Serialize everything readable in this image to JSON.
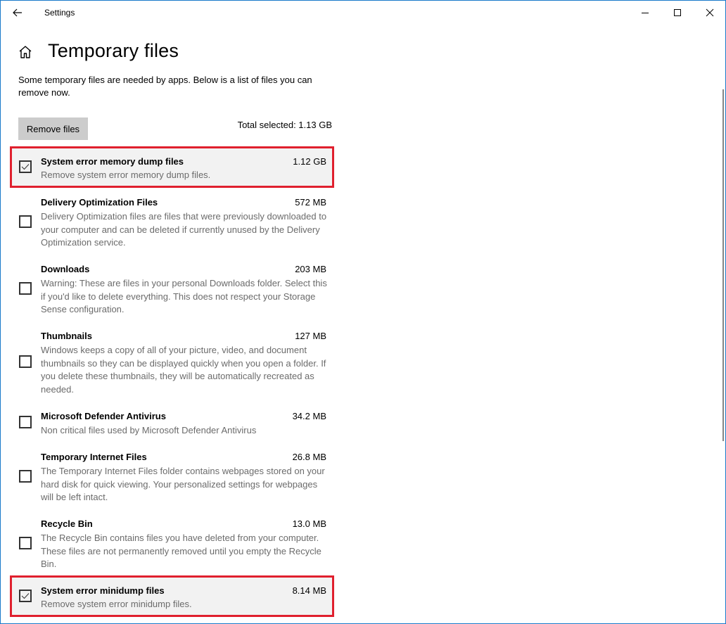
{
  "window": {
    "app_title": "Settings",
    "back_icon": "back-arrow-icon",
    "controls": {
      "minimize_icon": "minimize-icon",
      "maximize_icon": "maximize-icon",
      "close_icon": "close-icon"
    },
    "border_color": "#1979ca"
  },
  "page": {
    "home_icon": "home-icon",
    "title": "Temporary files",
    "intro": "Some temporary files are needed by apps. Below is a list of files you can remove now.",
    "remove_button_label": "Remove files",
    "total_selected": "Total selected: 1.13 GB"
  },
  "highlight_color": "#e0202e",
  "items": [
    {
      "name": "System error memory dump files",
      "size": "1.12 GB",
      "description": "Remove system error memory dump files.",
      "checked": true,
      "highlighted": true
    },
    {
      "name": "Delivery Optimization Files",
      "size": "572 MB",
      "description": "Delivery Optimization files are files that were previously downloaded to your computer and can be deleted if currently unused by the Delivery Optimization service.",
      "checked": false,
      "highlighted": false
    },
    {
      "name": "Downloads",
      "size": "203 MB",
      "description": "Warning: These are files in your personal Downloads folder. Select this if you'd like to delete everything. This does not respect your Storage Sense configuration.",
      "checked": false,
      "highlighted": false
    },
    {
      "name": "Thumbnails",
      "size": "127 MB",
      "description": "Windows keeps a copy of all of your picture, video, and document thumbnails so they can be displayed quickly when you open a folder. If you delete these thumbnails, they will be automatically recreated as needed.",
      "checked": false,
      "highlighted": false
    },
    {
      "name": "Microsoft Defender Antivirus",
      "size": "34.2 MB",
      "description": "Non critical files used by Microsoft Defender Antivirus",
      "checked": false,
      "highlighted": false
    },
    {
      "name": "Temporary Internet Files",
      "size": "26.8 MB",
      "description": "The Temporary Internet Files folder contains webpages stored on your hard disk for quick viewing. Your personalized settings for webpages will be left intact.",
      "checked": false,
      "highlighted": false
    },
    {
      "name": "Recycle Bin",
      "size": "13.0 MB",
      "description": "The Recycle Bin contains files you have deleted from your computer. These files are not permanently removed until you empty the Recycle Bin.",
      "checked": false,
      "highlighted": false
    },
    {
      "name": "System error minidump files",
      "size": "8.14 MB",
      "description": "Remove system error minidump files.",
      "checked": true,
      "highlighted": true
    }
  ]
}
